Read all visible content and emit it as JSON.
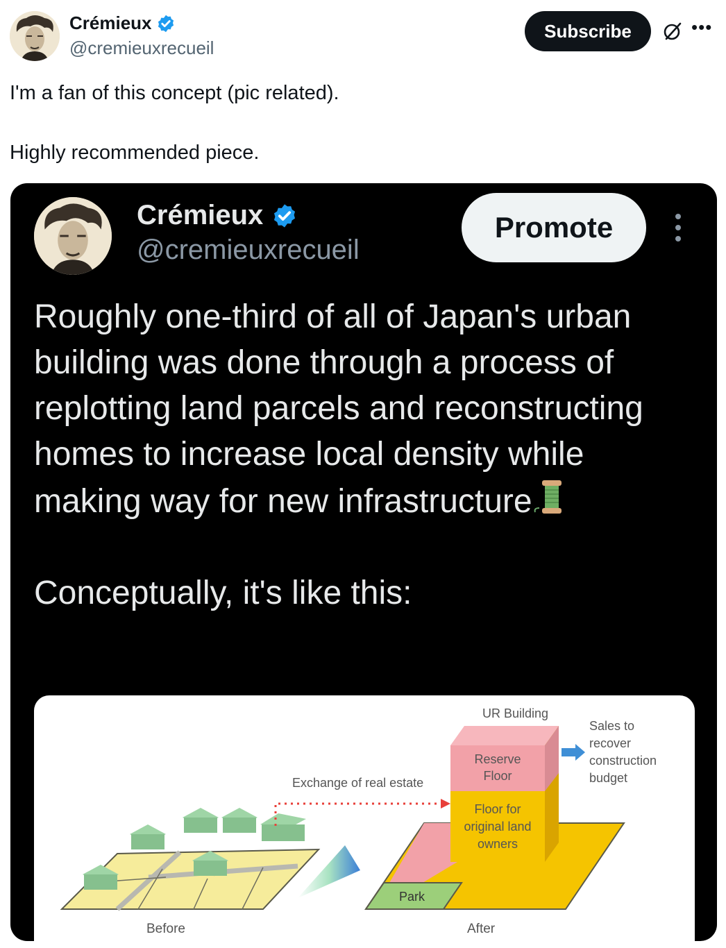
{
  "outer": {
    "display_name": "Crémieux",
    "handle": "@cremieuxrecueil",
    "subscribe_label": "Subscribe",
    "text_line1": "I'm a fan of this concept (pic related).",
    "text_line2": "Highly recommended piece."
  },
  "embed": {
    "display_name": "Crémieux",
    "handle": "@cremieuxrecueil",
    "promote_label": "Promote",
    "text_para1": "Roughly one-third of all of Japan's urban building was done through a process of replotting land parcels and reconstructing homes to increase local density while making way for new infrastructure",
    "text_para2": "Conceptually, it's like this:"
  },
  "diagram": {
    "exchange_label": "Exchange of real estate",
    "ur_building_label": "UR Building",
    "reserve_floor_line1": "Reserve",
    "reserve_floor_line2": "Floor",
    "floor_owners_line1": "Floor for",
    "floor_owners_line2": "original land",
    "floor_owners_line3": "owners",
    "sales_line1": "Sales to",
    "sales_line2": "recover",
    "sales_line3": "construction",
    "sales_line4": "budget",
    "park_label": "Park",
    "before_label": "Before",
    "after_label": "After"
  },
  "colors": {
    "verified_blue": "#1d9bf0",
    "embed_bg": "#000000",
    "building_yellow": "#f5c400",
    "reserve_pink": "#f2a1a8",
    "park_green": "#9ccf7a",
    "house_green": "#8fc99a",
    "arrow_red": "#e8403a",
    "arrow_blue": "#3f8fd6"
  },
  "icons": [
    "verified-badge-icon",
    "grok-icon",
    "more-icon",
    "spool-emoji-icon"
  ]
}
